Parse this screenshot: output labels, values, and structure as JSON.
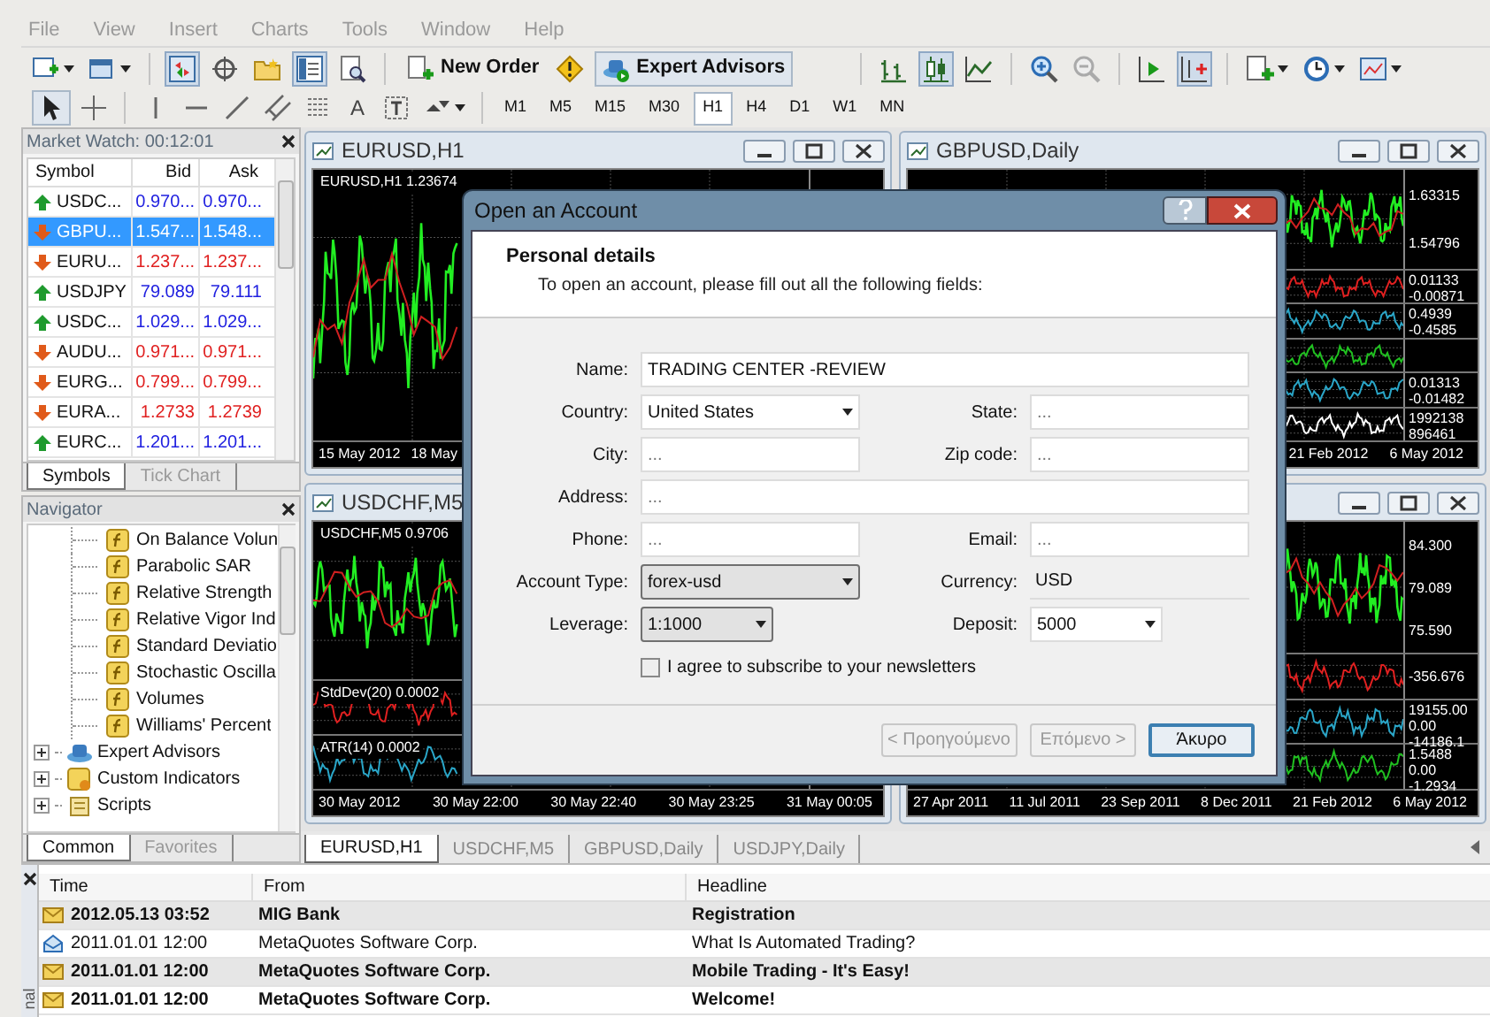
{
  "menu": [
    "File",
    "View",
    "Insert",
    "Charts",
    "Tools",
    "Window",
    "Help"
  ],
  "toolbar": {
    "new_order": "New Order",
    "expert_advisors": "Expert Advisors",
    "text_tool": "A",
    "timeframes": [
      {
        "label": "M1",
        "selected": false
      },
      {
        "label": "M5",
        "selected": false
      },
      {
        "label": "M15",
        "selected": false
      },
      {
        "label": "M30",
        "selected": false
      },
      {
        "label": "H1",
        "selected": true
      },
      {
        "label": "H4",
        "selected": false
      },
      {
        "label": "D1",
        "selected": false
      },
      {
        "label": "W1",
        "selected": false
      },
      {
        "label": "MN",
        "selected": false
      }
    ]
  },
  "market_watch": {
    "title": "Market Watch: 00:12:01",
    "columns": [
      "Symbol",
      "Bid",
      "Ask"
    ],
    "rows": [
      {
        "symbol": "USDC...",
        "bid": "0.970...",
        "ask": "0.970...",
        "rising": true,
        "selected": false
      },
      {
        "symbol": "GBPU...",
        "bid": "1.547...",
        "ask": "1.548...",
        "rising": false,
        "selected": true
      },
      {
        "symbol": "EURU...",
        "bid": "1.237...",
        "ask": "1.237...",
        "rising": false,
        "selected": false
      },
      {
        "symbol": "USDJPY",
        "bid": "79.089",
        "ask": "79.111",
        "rising": true,
        "selected": false
      },
      {
        "symbol": "USDC...",
        "bid": "1.029...",
        "ask": "1.029...",
        "rising": true,
        "selected": false
      },
      {
        "symbol": "AUDU...",
        "bid": "0.971...",
        "ask": "0.971...",
        "rising": false,
        "selected": false
      },
      {
        "symbol": "EURG...",
        "bid": "0.799...",
        "ask": "0.799...",
        "rising": false,
        "selected": false
      },
      {
        "symbol": "EURA...",
        "bid": "1.2733",
        "ask": "1.2739",
        "rising": false,
        "selected": false
      },
      {
        "symbol": "EURC...",
        "bid": "1.201...",
        "ask": "1.201...",
        "rising": true,
        "selected": false
      }
    ],
    "tabs": [
      {
        "label": "Symbols",
        "selected": true
      },
      {
        "label": "Tick Chart",
        "selected": false
      }
    ]
  },
  "navigator": {
    "title": "Navigator",
    "tree": [
      {
        "children": [
          {
            "label": "On Balance Volun",
            "kind": "indicator"
          },
          {
            "label": "Parabolic SAR",
            "kind": "indicator"
          },
          {
            "label": "Relative Strength",
            "kind": "indicator"
          },
          {
            "label": "Relative Vigor Ind",
            "kind": "indicator"
          },
          {
            "label": "Standard Deviatio",
            "kind": "indicator"
          },
          {
            "label": "Stochastic Oscilla",
            "kind": "indicator"
          },
          {
            "label": "Volumes",
            "kind": "indicator"
          },
          {
            "label": "Williams' Percent",
            "kind": "indicator"
          }
        ]
      },
      {
        "label": "Expert Advisors",
        "kind": "experts",
        "expanded": false
      },
      {
        "label": "Custom Indicators",
        "kind": "custom",
        "expanded": false
      },
      {
        "label": "Scripts",
        "kind": "scripts",
        "expanded": false
      }
    ],
    "tabs": [
      {
        "label": "Common",
        "selected": true
      },
      {
        "label": "Favorites",
        "selected": false
      }
    ]
  },
  "charts": [
    {
      "title": "EURUSD,H1",
      "panes": [
        {
          "kind": "main",
          "info": "EURUSD,H1 1.23674"
        }
      ],
      "dates": [
        "15 May 2012",
        "18 May"
      ]
    },
    {
      "title": "GBPUSD,Daily",
      "panes": [
        {
          "kind": "main",
          "labels": [
            "1.63315",
            "1.54796"
          ]
        },
        {
          "kind": "sub",
          "labels": [
            "0.01133",
            "-0.00871"
          ]
        },
        {
          "kind": "sub",
          "labels": [
            "0.4939",
            "-0.4585"
          ]
        },
        {
          "kind": "sub"
        },
        {
          "kind": "sub",
          "labels": [
            "0.01313",
            "-0.01482"
          ]
        },
        {
          "kind": "sub",
          "labels": [
            "1992138",
            "896461"
          ]
        }
      ],
      "dates": [
        "21 Feb 2012",
        "6 May 2012"
      ]
    },
    {
      "title": "USDCHF,M5",
      "panes": [
        {
          "kind": "main",
          "info": "USDCHF,M5 0.9706"
        },
        {
          "kind": "sub",
          "info": "StdDev(20) 0.0002"
        },
        {
          "kind": "sub",
          "info": "ATR(14) 0.0002"
        }
      ],
      "dates": [
        "30 May 2012",
        "30 May 22:00",
        "30 May 22:40",
        "30 May 23:25",
        "31 May 00:05"
      ]
    },
    {
      "panes": [
        {
          "kind": "main",
          "labels": [
            "84.300",
            "79.089",
            "75.590"
          ]
        },
        {
          "kind": "sub",
          "labels": [
            "-356.676"
          ]
        },
        {
          "kind": "sub",
          "labels": [
            "19155.00",
            "0.00",
            "-14186.1"
          ]
        },
        {
          "kind": "sub",
          "labels": [
            "1.5488",
            "0.00",
            "-1.2934"
          ]
        }
      ],
      "dates": [
        "27 Apr 2011",
        "11 Jul 2011",
        "23 Sep 2011",
        "8 Dec 2011",
        "21 Feb 2012",
        "6 May 2012"
      ]
    }
  ],
  "chart_tabs": [
    {
      "label": "EURUSD,H1",
      "selected": true
    },
    {
      "label": "USDCHF,M5",
      "selected": false
    },
    {
      "label": "GBPUSD,Daily",
      "selected": false
    },
    {
      "label": "USDJPY,Daily",
      "selected": false
    }
  ],
  "terminal": {
    "side_label": "nal",
    "columns": [
      "Time",
      "From",
      "Headline"
    ],
    "rows": [
      {
        "time": "2012.05.13 03:52",
        "from": "MIG Bank",
        "headline": "Registration",
        "read": false
      },
      {
        "time": "2011.01.01 12:00",
        "from": "MetaQuotes Software Corp.",
        "headline": "What Is Automated Trading?",
        "read": true
      },
      {
        "time": "2011.01.01 12:00",
        "from": "MetaQuotes Software Corp.",
        "headline": "Mobile Trading - It's Easy!",
        "read": false
      },
      {
        "time": "2011.01.01 12:00",
        "from": "MetaQuotes Software Corp.",
        "headline": "Welcome!",
        "read": false
      }
    ]
  },
  "dialog": {
    "title": "Open an Account",
    "heading": "Personal details",
    "subtitle": "To open an account, please fill out all the following fields:",
    "rows": [
      [
        {
          "label": "Name:",
          "kind": "text",
          "value": "TRADING CENTER -REVIEW"
        }
      ],
      [
        {
          "label": "Country:",
          "kind": "combo",
          "value": "United States"
        },
        {
          "label": "State:",
          "kind": "text",
          "placeholder": "..."
        }
      ],
      [
        {
          "label": "City:",
          "kind": "text",
          "placeholder": "..."
        },
        {
          "label": "Zip code:",
          "kind": "text",
          "placeholder": "..."
        }
      ],
      [
        {
          "label": "Address:",
          "kind": "text",
          "placeholder": "..."
        }
      ],
      [
        {
          "label": "Phone:",
          "kind": "text",
          "placeholder": "..."
        },
        {
          "label": "Email:",
          "kind": "text",
          "placeholder": "..."
        }
      ],
      [
        {
          "label": "Account Type:",
          "kind": "list",
          "value": "forex-usd"
        },
        {
          "label": "Currency:",
          "kind": "static",
          "value": "USD"
        }
      ],
      [
        {
          "label": "Leverage:",
          "kind": "list",
          "value": "1:1000"
        },
        {
          "label": "Deposit:",
          "kind": "combo",
          "value": "5000"
        }
      ]
    ],
    "checkbox": {
      "label": "I agree to subscribe to your newsletters",
      "checked": false
    },
    "buttons": [
      {
        "label": "< Προηγούμενο",
        "disabled": true,
        "default": false
      },
      {
        "label": "Επόμενο >",
        "disabled": true,
        "default": false
      },
      {
        "label": "Άκυρο",
        "disabled": false,
        "default": true
      }
    ]
  }
}
